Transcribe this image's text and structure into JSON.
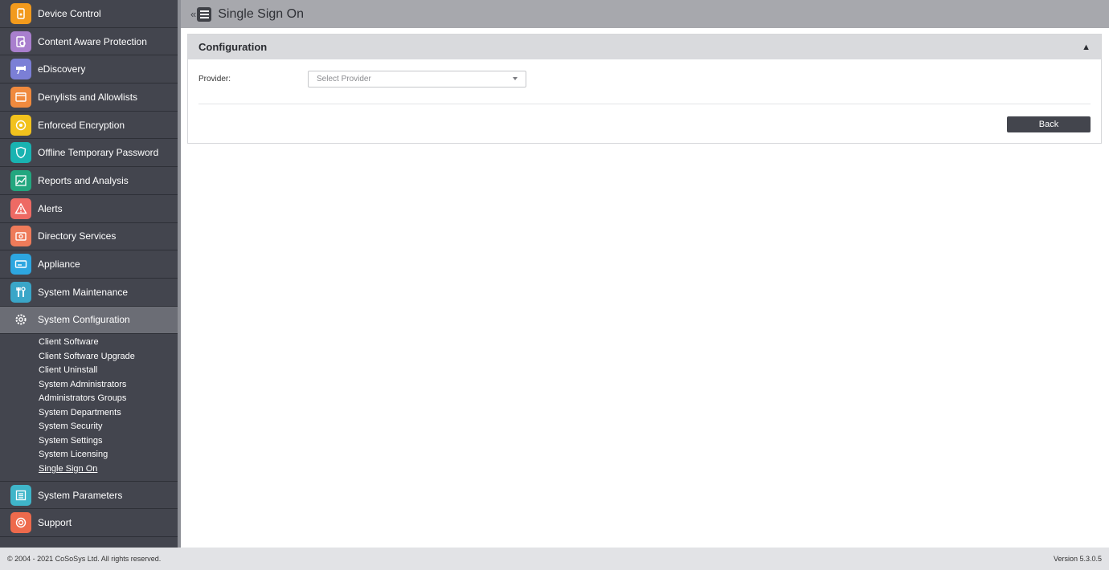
{
  "sidebar": {
    "items": [
      {
        "label": "Device Control",
        "icon": "device-control-icon",
        "color": "#f29a1d"
      },
      {
        "label": "Content Aware Protection",
        "icon": "content-aware-icon",
        "color": "#a97fce"
      },
      {
        "label": "eDiscovery",
        "icon": "ediscovery-icon",
        "color": "#7b7fd6"
      },
      {
        "label": "Denylists and Allowlists",
        "icon": "denylist-icon",
        "color": "#f08a3e"
      },
      {
        "label": "Enforced Encryption",
        "icon": "encryption-icon",
        "color": "#f2c21d"
      },
      {
        "label": "Offline Temporary Password",
        "icon": "shield-icon",
        "color": "#19b3b1"
      },
      {
        "label": "Reports and Analysis",
        "icon": "chart-icon",
        "color": "#23a77f"
      },
      {
        "label": "Alerts",
        "icon": "alert-icon",
        "color": "#ee6a64"
      },
      {
        "label": "Directory Services",
        "icon": "directory-icon",
        "color": "#ee7b5a"
      },
      {
        "label": "Appliance",
        "icon": "appliance-icon",
        "color": "#2da6e0"
      },
      {
        "label": "System Maintenance",
        "icon": "tools-icon",
        "color": "#3aa6c8"
      },
      {
        "label": "System Configuration",
        "icon": "gear-icon",
        "color": "#6b6d75",
        "active": true
      }
    ],
    "sub_items": [
      "Client Software",
      "Client Software Upgrade",
      "Client Uninstall",
      "System Administrators",
      "Administrators Groups",
      "System Departments",
      "System Security",
      "System Settings",
      "System Licensing",
      "Single Sign On"
    ],
    "bottom_items": [
      {
        "label": "System Parameters",
        "icon": "list-icon",
        "color": "#3fb5c9"
      },
      {
        "label": "Support",
        "icon": "support-icon",
        "color": "#ee6a4c"
      }
    ]
  },
  "header": {
    "collapse_symbol": "«",
    "title": "Single Sign On"
  },
  "panel": {
    "title": "Configuration",
    "chevron": "▲",
    "provider_label": "Provider:",
    "provider_placeholder": "Select Provider",
    "back_label": "Back"
  },
  "footer": {
    "copyright": "© 2004 - 2021 CoSoSys Ltd. All rights reserved.",
    "version": "Version 5.3.0.5"
  }
}
